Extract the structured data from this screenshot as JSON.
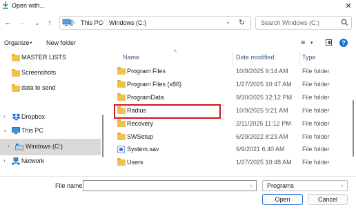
{
  "window": {
    "title": "Open with..."
  },
  "nav": {
    "back_glyph": "←",
    "forward_glyph": "→",
    "recent_glyph": "⌄",
    "up_glyph": "↑"
  },
  "address": {
    "separator": "›",
    "crumbs": [
      "This PC",
      "Windows (C:)"
    ],
    "dropdown_glyph": "⌄",
    "refresh_glyph": "↻"
  },
  "search": {
    "placeholder": "Search Windows (C:)"
  },
  "toolbar": {
    "organize_label": "Organize",
    "organize_caret": "▾",
    "new_folder_label": "New folder",
    "view_glyph": "≡",
    "view_caret": "▾",
    "help_glyph": "?"
  },
  "sidebar": {
    "items": [
      {
        "label": "MASTER LISTS",
        "icon": "folder-icon"
      },
      {
        "label": "Screenshots",
        "icon": "folder-icon"
      },
      {
        "label": "data to send",
        "icon": "folder-icon"
      },
      {
        "label": "Dropbox",
        "icon": "dropbox-icon"
      },
      {
        "label": "This PC",
        "icon": "computer-icon"
      },
      {
        "label": "Windows (C:)",
        "icon": "drive-icon",
        "selected": true
      },
      {
        "label": "Network",
        "icon": "network-icon"
      }
    ]
  },
  "file_list": {
    "sort_glyph": "^",
    "columns": {
      "name": "Name",
      "date": "Date modified",
      "type": "Type"
    },
    "rows": [
      {
        "name": "Program Files",
        "date": "10/9/2025 9:14 AM",
        "type": "File folder"
      },
      {
        "name": "Program Files (x86)",
        "date": "1/27/2025 10:47 AM",
        "type": "File folder"
      },
      {
        "name": "ProgramData",
        "date": "9/30/2025 12:12 PM",
        "type": "File folder"
      },
      {
        "name": "Radius",
        "date": "10/9/2025 9:21 AM",
        "type": "File folder",
        "highlighted": true
      },
      {
        "name": "Recovery",
        "date": "2/11/2025 11:12 PM",
        "type": "File folder"
      },
      {
        "name": "SWSetup",
        "date": "6/29/2022 8:23 AM",
        "type": "File folder"
      },
      {
        "name": "System.sav",
        "date": "6/9/2021 6:40 AM",
        "type": "File folder"
      },
      {
        "name": "Users",
        "date": "1/27/2025 10:48 AM",
        "type": "File folder"
      }
    ]
  },
  "footer": {
    "file_name_label": "File name:",
    "file_name_value": "",
    "file_name_caret": "⌄",
    "file_type_value": "Programs",
    "file_type_caret": "⌄",
    "open_label": "Open",
    "cancel_label": "Cancel"
  },
  "colors": {
    "accent": "#2a6ed1",
    "highlight": "#d4131a",
    "folder": "#f0c24b",
    "selected_bg": "#d9d9d9"
  }
}
